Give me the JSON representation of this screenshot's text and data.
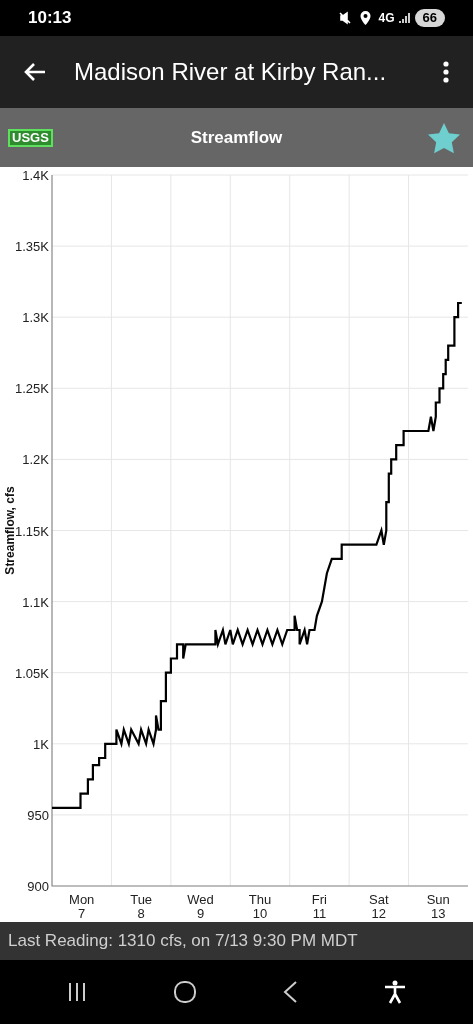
{
  "status_bar": {
    "time": "10:13",
    "network": "4G",
    "battery": "66"
  },
  "app_bar": {
    "title": "Madison River at Kirby Ran..."
  },
  "toolbar": {
    "source_badge": "USGS",
    "title": "Streamflow",
    "favorite": true
  },
  "chart_data": {
    "type": "line",
    "ylabel": "Streamflow, cfs",
    "xlim": [
      6.5,
      13.5
    ],
    "ylim": [
      900,
      1400
    ],
    "yticks": [
      {
        "value": 900,
        "label": "900"
      },
      {
        "value": 950,
        "label": "950"
      },
      {
        "value": 1000,
        "label": "1K"
      },
      {
        "value": 1050,
        "label": "1.05K"
      },
      {
        "value": 1100,
        "label": "1.1K"
      },
      {
        "value": 1150,
        "label": "1.15K"
      },
      {
        "value": 1200,
        "label": "1.2K"
      },
      {
        "value": 1250,
        "label": "1.25K"
      },
      {
        "value": 1300,
        "label": "1.3K"
      },
      {
        "value": 1350,
        "label": "1.35K"
      },
      {
        "value": 1400,
        "label": "1.4K"
      }
    ],
    "grid": true,
    "xticks": [
      7,
      8,
      9,
      10,
      11,
      12,
      13
    ],
    "x": [
      6.5,
      6.979,
      6.979,
      7.104,
      7.104,
      7.188,
      7.188,
      7.292,
      7.292,
      7.396,
      7.396,
      7.583,
      7.583,
      7.667,
      7.708,
      7.792,
      7.833,
      7.958,
      8,
      8.083,
      8.125,
      8.208,
      8.25,
      8.25,
      8.292,
      8.333,
      8.333,
      8.417,
      8.417,
      8.5,
      8.5,
      8.604,
      8.604,
      8.708,
      8.708,
      8.75,
      9.25,
      9.25,
      9.292,
      9.375,
      9.417,
      9.5,
      9.542,
      9.625,
      9.708,
      9.792,
      9.875,
      9.958,
      10.042,
      10.125,
      10.208,
      10.292,
      10.375,
      10.458,
      10.583,
      10.583,
      10.625,
      10.667,
      10.667,
      10.75,
      10.792,
      10.833,
      10.917,
      10.958,
      11.042,
      11.042,
      11.125,
      11.125,
      11.208,
      11.208,
      11.375,
      11.375,
      11.542,
      11.542,
      11.958,
      12.042,
      12.083,
      12.125,
      12.125,
      12.167,
      12.167,
      12.208,
      12.208,
      12.292,
      12.292,
      12.417,
      12.417,
      12.792,
      12.833,
      12.875,
      12.917,
      12.958,
      12.958,
      13.021,
      13.021,
      13.083,
      13.083,
      13.125,
      13.125,
      13.167,
      13.167,
      13.271,
      13.271,
      13.333,
      13.333,
      13.396
    ],
    "series": [
      {
        "color": "#000000",
        "values": [
          955,
          955,
          965,
          965,
          975,
          975,
          985,
          985,
          990,
          990,
          1000,
          1000,
          1010,
          1000,
          1010,
          1000,
          1010,
          1000,
          1010,
          1000,
          1010,
          1000,
          1010,
          1020,
          1010,
          1010,
          1030,
          1030,
          1050,
          1050,
          1060,
          1060,
          1070,
          1070,
          1060,
          1070,
          1070,
          1080,
          1070,
          1080,
          1070,
          1080,
          1070,
          1080,
          1070,
          1080,
          1070,
          1080,
          1070,
          1080,
          1070,
          1080,
          1070,
          1080,
          1080,
          1090,
          1080,
          1080,
          1070,
          1080,
          1070,
          1080,
          1080,
          1090,
          1100,
          1100,
          1120,
          1120,
          1130,
          1130,
          1130,
          1140,
          1140,
          1140,
          1140,
          1150,
          1140,
          1150,
          1170,
          1170,
          1190,
          1190,
          1200,
          1200,
          1210,
          1210,
          1220,
          1220,
          1220,
          1230,
          1220,
          1230,
          1240,
          1240,
          1250,
          1250,
          1260,
          1260,
          1270,
          1270,
          1280,
          1280,
          1300,
          1300,
          1310,
          1310
        ]
      }
    ]
  },
  "x_axis_weekdays": [
    "Mon",
    "Tue",
    "Wed",
    "Thu",
    "Fri",
    "Sat",
    "Sun"
  ],
  "footer": {
    "last_reading": "Last Reading: 1310 cfs, on 7/13 9:30 PM MDT"
  }
}
